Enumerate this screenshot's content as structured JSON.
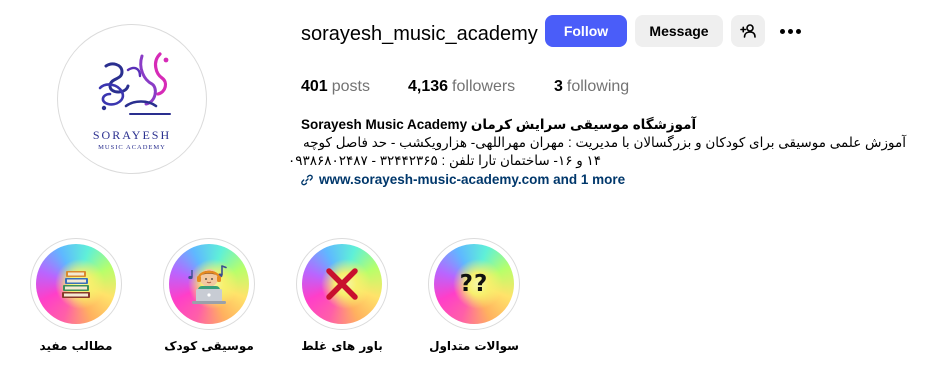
{
  "profile": {
    "username": "sorayesh_music_academy",
    "avatar_logo_text": "SORAYESH",
    "avatar_logo_subtext": "MUSIC ACADEMY"
  },
  "actions": {
    "follow_label": "Follow",
    "message_label": "Message",
    "add_user_icon": "person-plus-icon",
    "more_icon": "more-options-icon"
  },
  "stats": {
    "posts_count": "401",
    "posts_label": "posts",
    "followers_count": "4,136",
    "followers_label": "followers",
    "following_count": "3",
    "following_label": "following"
  },
  "bio": {
    "name": "Sorayesh Music Academy آموزشگاه موسیقی سرایش کرمان",
    "line1": "آموزش علمی موسیقی برای کودکان و بزرگسالان با مدیریت : مهران مهراللهی- هزارویکشب - حد فاصل کوچه",
    "line2": "۱۴ و ۱۶- ساختمان تارا تلفن : ۳۲۴۴۲۳۶۵ - ۰۹۳۸۶۸۰۲۴۸۷",
    "link_text": "www.sorayesh-music-academy.com and 1 more",
    "link_icon": "link-icon"
  },
  "highlights": [
    {
      "label": "مطالب مفید",
      "icon": "books-icon"
    },
    {
      "label": "موسیقی کودک",
      "icon": "child-laptop-icon"
    },
    {
      "label": "باور های غلط",
      "icon": "red-x-icon"
    },
    {
      "label": "سوالات متداول",
      "icon": "question-marks-icon",
      "symbol": "??"
    }
  ],
  "colors": {
    "follow_bg": "#4a5df9",
    "secondary_bg": "#efefef",
    "link": "#00376b",
    "muted": "#737373",
    "logo_blue": "#2a2f8f",
    "logo_pink": "#d62bb7"
  }
}
